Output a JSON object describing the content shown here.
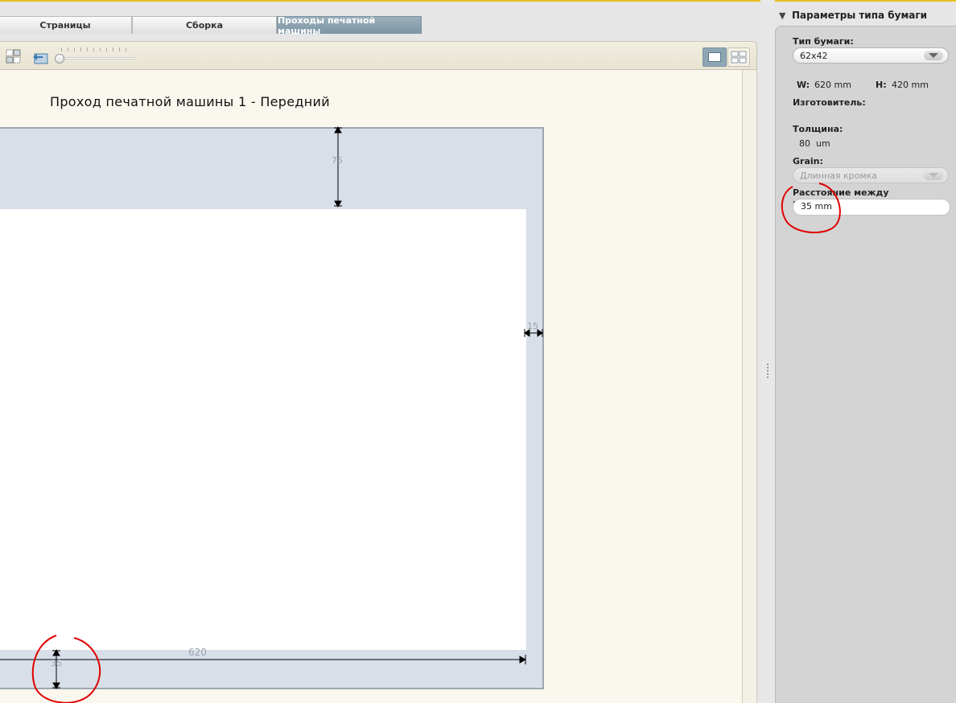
{
  "tabs": [
    {
      "label": "Страницы",
      "active": false
    },
    {
      "label": "Сборка",
      "active": false
    },
    {
      "label": "Проходы печатной машины",
      "active": true
    }
  ],
  "canvas": {
    "title": "Проход печатной машины 1 - Передний",
    "dimensions": {
      "top": "75",
      "right": "15",
      "width": "620",
      "bottom": "35"
    }
  },
  "panel": {
    "title": "Параметры типа бумаги",
    "paper_type_label": "Тип бумаги:",
    "paper_type_value": "62x42",
    "w_label": "W:",
    "w_value": "620 mm",
    "h_label": "H:",
    "h_value": "420 mm",
    "manufacturer_label": "Изготовитель:",
    "thickness_label": "Толщина:",
    "thickness_value": "80",
    "thickness_unit": "um",
    "grain_label": "Grain:",
    "grain_value": "Длинная кромка",
    "perforation_label": "Расстояние между перфорацией:",
    "perforation_value": "35 mm"
  },
  "colors": {
    "accent_tab": "#8ea6b4",
    "sheet": "#d8dfe8",
    "annotation": "#e00000",
    "top_line": "#e8c01e"
  }
}
